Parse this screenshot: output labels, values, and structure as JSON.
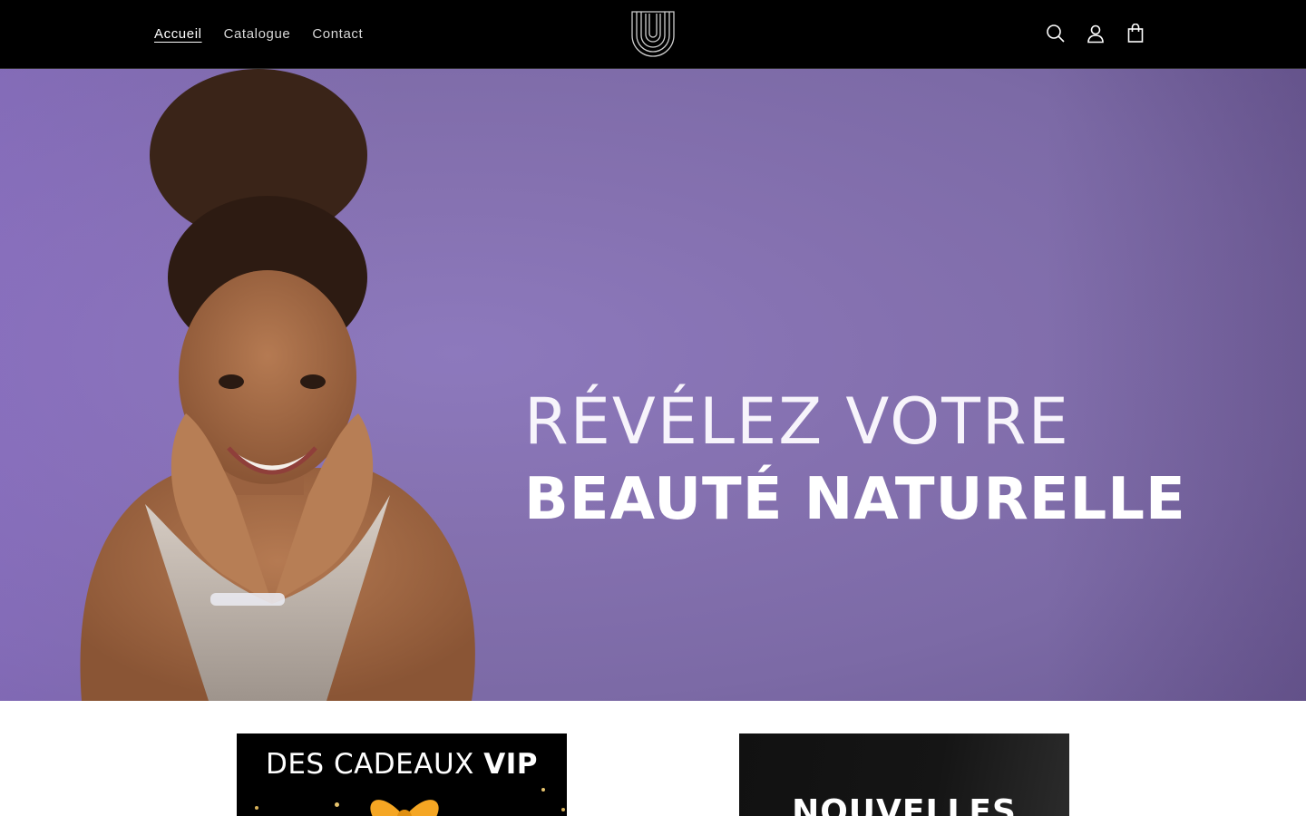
{
  "header": {
    "nav": [
      {
        "label": "Accueil"
      },
      {
        "label": "Catalogue"
      },
      {
        "label": "Contact"
      }
    ],
    "logo_icon": "brand-logo-icon",
    "actions": {
      "search_icon": "search-icon",
      "account_icon": "account-icon",
      "cart_icon": "cart-icon"
    }
  },
  "hero": {
    "line1": "RÉVÉLEZ VOTRE",
    "line2": "BEAUTÉ NATURELLE",
    "background_color": "#8473b0"
  },
  "promos": {
    "vip": {
      "title_regular": "DES CADEAUX ",
      "title_bold": "VIP"
    },
    "new": {
      "title": "NOUVELLES"
    }
  },
  "colors": {
    "header_bg": "#000000",
    "accent_purple": "#8473b0",
    "text_light": "#ffffff"
  }
}
